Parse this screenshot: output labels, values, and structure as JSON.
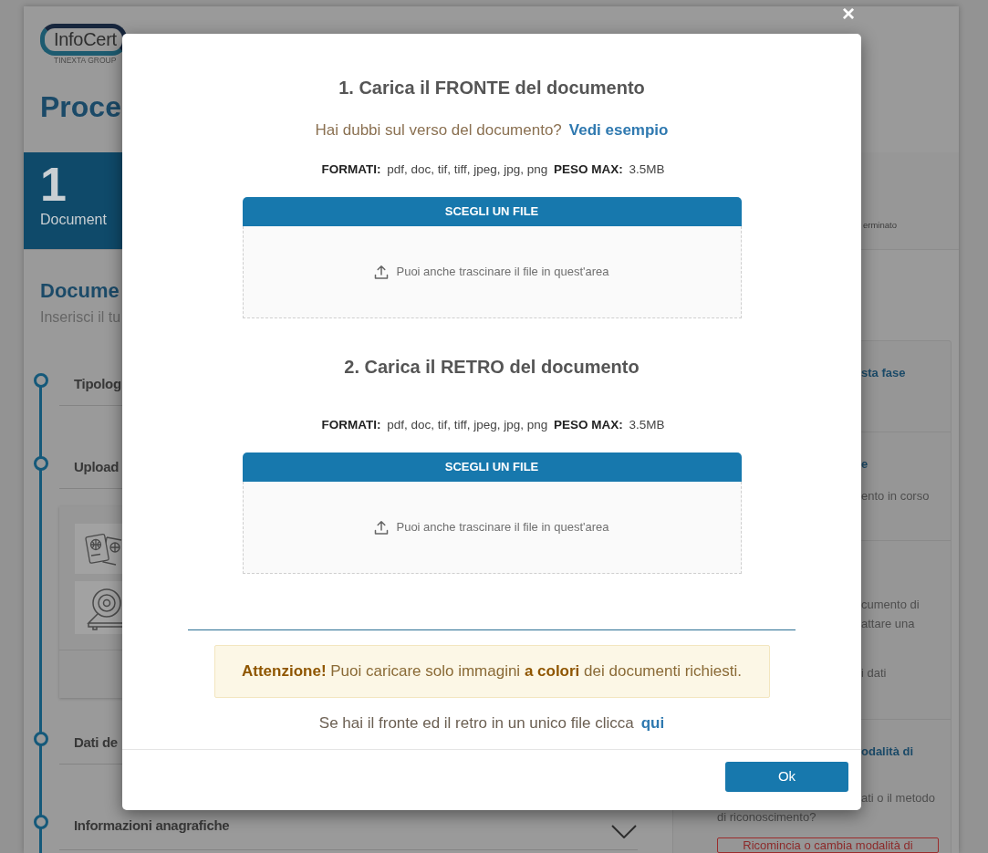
{
  "logo": {
    "wordmark": "InfoCert",
    "tagline": "TINEXTA GROUP"
  },
  "page_title": "Proce",
  "steps": [
    {
      "number": "1",
      "label": "Document",
      "selected": true
    },
    {
      "label": "erminato",
      "selected": false
    }
  ],
  "section": {
    "title": "Docume",
    "subtitle": "Inserisci il tu"
  },
  "timeline": [
    {
      "label": "Tipolog"
    },
    {
      "label": "Upload",
      "expanded": true
    },
    {
      "label": "Dati de"
    },
    {
      "label": "Informazioni anagrafiche",
      "expanded": false
    }
  ],
  "sidebar": {
    "sections": [
      {
        "title": "sta fase"
      },
      {
        "title": "e",
        "paragraphs": [
          [
            "ento in corso"
          ]
        ]
      },
      {
        "paragraphs": [
          [
            "cumento di",
            "attare una"
          ],
          [
            "i dati"
          ]
        ]
      },
      {
        "title": "odalità di",
        "paragraphs": [
          [
            "ati o il metodo"
          ]
        ],
        "note": "di riconoscimento?",
        "button": "Ricomincia o cambia modalità di"
      }
    ]
  },
  "dialog": {
    "close": "×",
    "uploads": [
      {
        "title": "1. Carica il FRONTE del documento",
        "hint": "Hai dubbi sul verso del documento?",
        "hint_link": "Vedi esempio",
        "formats": "**FORMATI:** pdf, doc, tif, tiff, jpeg, jpg, png **PESO MAX:** 3.5MB",
        "button": "SCEGLI UN FILE",
        "drop_text": "Puoi anche trascinare il file in quest'area"
      },
      {
        "title": "2. Carica il RETRO del documento",
        "formats": "**FORMATI:** pdf, doc, tif, tiff, jpeg, jpg, png **PESO MAX:** 3.5MB",
        "button": "SCEGLI UN FILE",
        "drop_text": "Puoi anche trascinare il file in quest'area"
      }
    ],
    "alert": "**Attenzione!** Puoi caricare solo immagini **a colori** dei documenti richiesti.",
    "single_file": {
      "text": "Se hai il fronte ed il retro in un unico file clicca",
      "link": "qui"
    },
    "ok": "Ok"
  }
}
